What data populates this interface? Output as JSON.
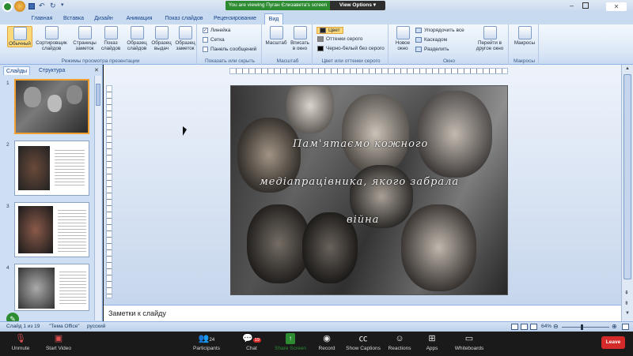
{
  "share_banner": {
    "text": "You are viewing Пуган Єлизавета's screen",
    "view_options": "View Options"
  },
  "ribbon_tabs": [
    "Главная",
    "Вставка",
    "Дизайн",
    "Анимация",
    "Показ слайдов",
    "Рецензирование",
    "Вид"
  ],
  "active_tab": "Вид",
  "ribbon": {
    "view_modes": {
      "label": "Режимы просмотра презентации",
      "buttons": [
        "Обычный",
        "Сортировщик слайдов",
        "Страницы заметок",
        "Показ слайдов",
        "Образец слайдов",
        "Образец выдач",
        "Образец заметок"
      ]
    },
    "show_hide": {
      "label": "Показать или скрыть",
      "items": [
        {
          "text": "Линейка",
          "checked": true
        },
        {
          "text": "Сетка",
          "checked": false
        },
        {
          "text": "Панель сообщений",
          "checked": false
        }
      ]
    },
    "zoom": {
      "label": "Масштаб",
      "buttons": [
        "Масштаб",
        "Вписать в окно"
      ]
    },
    "color": {
      "label": "Цвет или оттенки серого",
      "items": [
        "Цвет",
        "Оттенки серого",
        "Черно-белый без серого"
      ]
    },
    "window": {
      "label": "Окно",
      "new_window": "Новое окно",
      "items": [
        "Упорядочить все",
        "Каскадом",
        "Разделить"
      ],
      "switch": "Перейти в другое окно"
    },
    "macros": {
      "label": "Макросы",
      "button": "Макросы"
    }
  },
  "panel_tabs": [
    "Слайды",
    "Структура"
  ],
  "slides": [
    "1",
    "2",
    "3",
    "4"
  ],
  "slide": {
    "lines": [
      "Пам'ятаємо кожного",
      "медіапрацівника, якого забрала",
      "війна"
    ]
  },
  "notes_placeholder": "Заметки к слайду",
  "status": {
    "slide": "Слайд 1 из 19",
    "theme": "\"Тема Office\"",
    "lang": "русский",
    "zoom": "64%"
  },
  "zoom_toolbar": [
    {
      "label": "Unmute",
      "icon": "mic-off-icon"
    },
    {
      "label": "Start Video",
      "icon": "video-off-icon"
    },
    {
      "label": "Participants",
      "icon": "participants-icon",
      "count": "24"
    },
    {
      "label": "Chat",
      "icon": "chat-icon",
      "badge": "19"
    },
    {
      "label": "Share Screen",
      "icon": "share-screen-icon"
    },
    {
      "label": "Record",
      "icon": "record-icon"
    },
    {
      "label": "Show Captions",
      "icon": "captions-icon"
    },
    {
      "label": "Reactions",
      "icon": "reactions-icon"
    },
    {
      "label": "Apps",
      "icon": "apps-icon"
    },
    {
      "label": "Whiteboards",
      "icon": "whiteboards-icon"
    }
  ],
  "leave": "Leave",
  "colors": {
    "share_green": "#2d8b32",
    "leave_red": "#d52a2a",
    "ribbon_blue": "#c8daf0"
  }
}
